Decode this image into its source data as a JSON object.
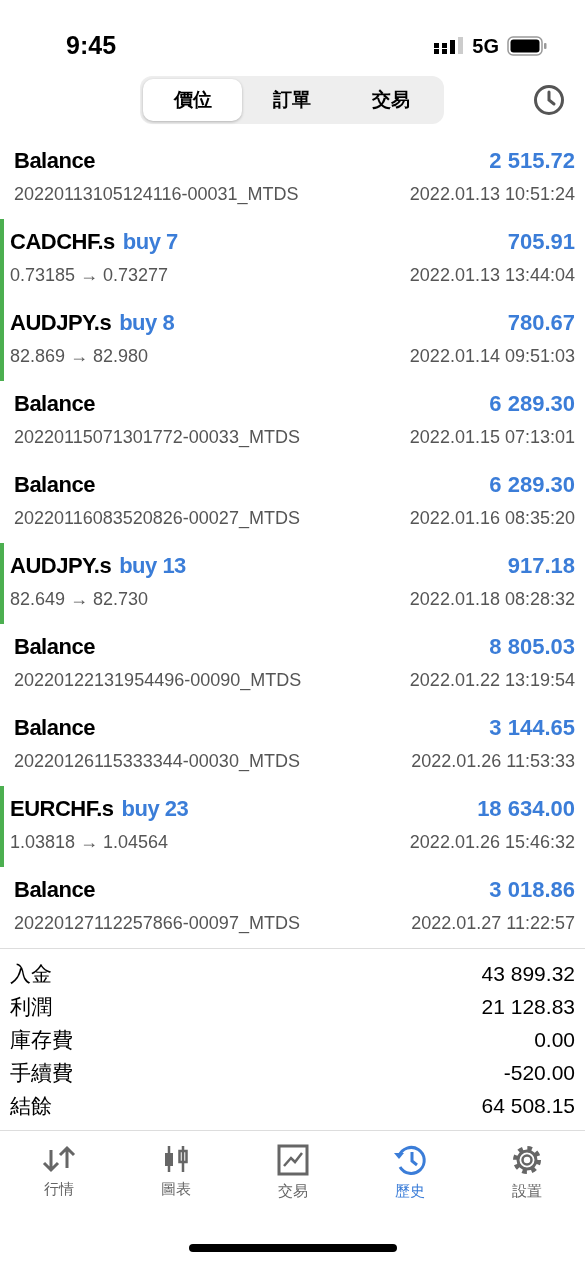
{
  "status_bar": {
    "time": "9:45",
    "network": "5G"
  },
  "segments": [
    {
      "label": "價位",
      "selected": true
    },
    {
      "label": "訂單",
      "selected": false
    },
    {
      "label": "交易",
      "selected": false
    }
  ],
  "deals": [
    {
      "kind": "balance",
      "title": "Balance",
      "amount": "2 515.72",
      "detail": "20220113105124116-00031_MTDS",
      "time": "2022.01.13 10:51:24"
    },
    {
      "kind": "trade",
      "title": "CADCHF.s",
      "action": "buy 7",
      "amount": "705.91",
      "detail": "0.73185 → 0.73277",
      "time": "2022.01.13 13:44:04"
    },
    {
      "kind": "trade",
      "title": "AUDJPY.s",
      "action": "buy 8",
      "amount": "780.67",
      "detail": "82.869 → 82.980",
      "time": "2022.01.14 09:51:03"
    },
    {
      "kind": "balance",
      "title": "Balance",
      "amount": "6 289.30",
      "detail": "20220115071301772-00033_MTDS",
      "time": "2022.01.15 07:13:01"
    },
    {
      "kind": "balance",
      "title": "Balance",
      "amount": "6 289.30",
      "detail": "20220116083520826-00027_MTDS",
      "time": "2022.01.16 08:35:20"
    },
    {
      "kind": "trade",
      "title": "AUDJPY.s",
      "action": "buy 13",
      "amount": "917.18",
      "detail": "82.649 → 82.730",
      "time": "2022.01.18 08:28:32"
    },
    {
      "kind": "balance",
      "title": "Balance",
      "amount": "8 805.03",
      "detail": "20220122131954496-00090_MTDS",
      "time": "2022.01.22 13:19:54"
    },
    {
      "kind": "balance",
      "title": "Balance",
      "amount": "3 144.65",
      "detail": "20220126115333344-00030_MTDS",
      "time": "2022.01.26 11:53:33"
    },
    {
      "kind": "trade",
      "title": "EURCHF.s",
      "action": "buy 23",
      "amount": "18 634.00",
      "detail": "1.03818 → 1.04564",
      "time": "2022.01.26 15:46:32"
    },
    {
      "kind": "balance",
      "title": "Balance",
      "amount": "3 018.86",
      "detail": "20220127112257866-00097_MTDS",
      "time": "2022.01.27 11:22:57"
    }
  ],
  "summary": [
    {
      "label": "入金",
      "value": "43 899.32"
    },
    {
      "label": "利潤",
      "value": "21 128.83"
    },
    {
      "label": "庫存費",
      "value": "0.00"
    },
    {
      "label": "手續費",
      "value": "-520.00"
    },
    {
      "label": "結餘",
      "value": "64 508.15"
    }
  ],
  "tab_bar": [
    {
      "kind": "quotes",
      "label": "行情",
      "selected": false
    },
    {
      "kind": "chart",
      "label": "圖表",
      "selected": false
    },
    {
      "kind": "trade",
      "label": "交易",
      "selected": false
    },
    {
      "kind": "history",
      "label": "歷史",
      "selected": true
    },
    {
      "kind": "settings",
      "label": "設置",
      "selected": false
    }
  ]
}
